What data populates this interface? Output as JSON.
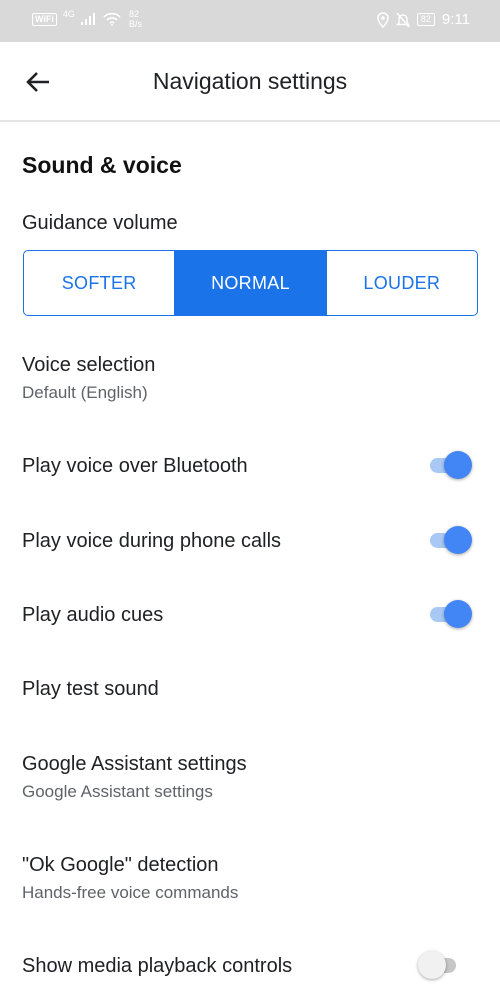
{
  "status_bar": {
    "wifi_label": "WiFi",
    "network_gen": "4G",
    "speed_value": "82",
    "speed_unit": "B/s",
    "battery": "82",
    "time": "9:11"
  },
  "app_bar": {
    "title": "Navigation settings"
  },
  "sound_voice": {
    "section_title": "Sound & voice",
    "guidance_volume": {
      "label": "Guidance volume",
      "options": [
        "SOFTER",
        "NORMAL",
        "LOUDER"
      ],
      "selected": "NORMAL"
    },
    "voice_selection": {
      "label": "Voice selection",
      "value": "Default (English)"
    },
    "bluetooth": {
      "label": "Play voice over Bluetooth",
      "enabled": true
    },
    "phone_calls": {
      "label": "Play voice during phone calls",
      "enabled": true
    },
    "audio_cues": {
      "label": "Play audio cues",
      "enabled": true
    },
    "test_sound": {
      "label": "Play test sound"
    },
    "assistant": {
      "label": "Google Assistant settings",
      "subtitle": "Google Assistant settings"
    },
    "ok_google": {
      "label": "\"Ok Google\" detection",
      "subtitle": "Hands-free voice commands"
    },
    "media_controls": {
      "label": "Show media playback controls",
      "enabled": false
    }
  },
  "colors": {
    "accent": "#1a73e8",
    "switch_on": "#4285f4",
    "status_bar_bg": "#d9d9d9"
  }
}
